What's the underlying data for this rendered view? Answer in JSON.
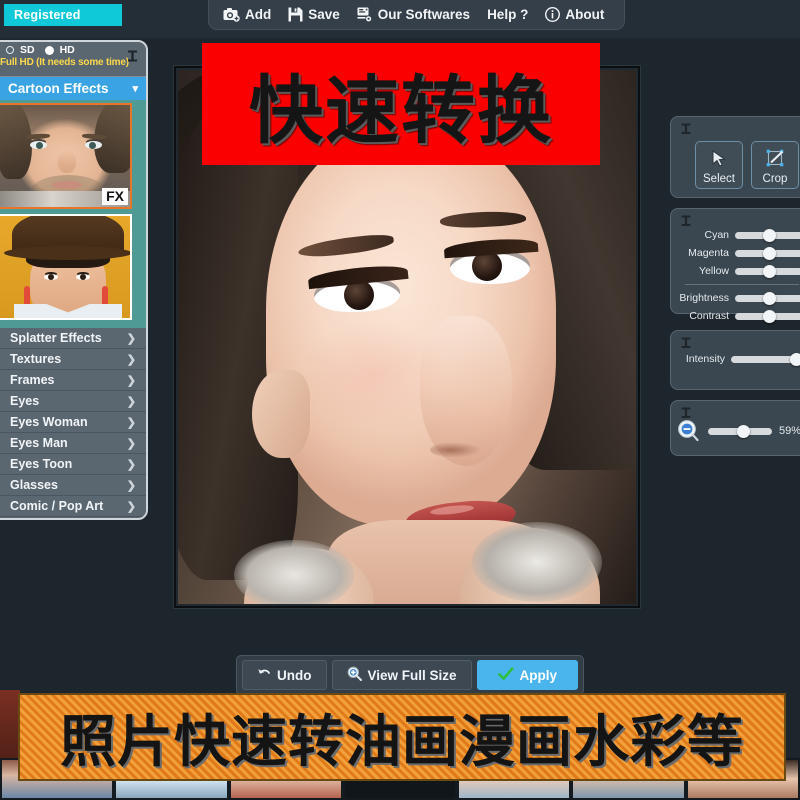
{
  "app": {
    "license_badge": "Registered"
  },
  "toolbar": {
    "items": [
      {
        "label": "Add",
        "icon": "camera-add-icon"
      },
      {
        "label": "Save",
        "icon": "floppy-disk-icon"
      },
      {
        "label": "Our Softwares",
        "icon": "monitor-icon"
      },
      {
        "label": "Help ?",
        "icon": "none"
      },
      {
        "label": "About",
        "icon": "info-circle-icon"
      }
    ]
  },
  "sidebar": {
    "quality": {
      "sd_label": "SD",
      "hd_label": "HD",
      "note": "Full HD (It needs some time)",
      "selected": "HD"
    },
    "category_header": {
      "label": "Cartoon Effects",
      "chevron": "chevron-down-icon"
    },
    "thumbnails": [
      {
        "name": "cartoon-effect-preview-1",
        "badge": "FX",
        "selected": true
      },
      {
        "name": "cartoon-effect-preview-2",
        "badge": "",
        "selected": false
      }
    ],
    "items": [
      {
        "label": "Splatter Effects"
      },
      {
        "label": "Textures"
      },
      {
        "label": "Frames"
      },
      {
        "label": "Eyes"
      },
      {
        "label": "Eyes Woman"
      },
      {
        "label": "Eyes Man"
      },
      {
        "label": "Eyes Toon"
      },
      {
        "label": "Glasses"
      },
      {
        "label": "Comic / Pop Art"
      }
    ],
    "arrow_icon": "chevron-right-icon"
  },
  "right_panel": {
    "tools": [
      {
        "label": "Select",
        "icon": "cursor-arrow-icon"
      },
      {
        "label": "Crop",
        "icon": "crop-icon"
      }
    ],
    "color_sliders": [
      {
        "label": "Cyan",
        "value": 50
      },
      {
        "label": "Magenta",
        "value": 50
      },
      {
        "label": "Yellow",
        "value": 50
      }
    ],
    "tone_sliders": [
      {
        "label": "Brightness",
        "value": 50
      },
      {
        "label": "Contrast",
        "value": 50
      }
    ],
    "intensity": {
      "label": "Intensity",
      "value": 100
    },
    "zoom": {
      "value": 45,
      "percent_label": "59%",
      "icon": "magnifier-minus-icon"
    }
  },
  "bottom_bar": {
    "buttons": [
      {
        "label": "Undo",
        "icon": "undo-arrow-icon"
      },
      {
        "label": "View Full Size",
        "icon": "magnifier-plus-icon"
      },
      {
        "label": "Apply",
        "icon": "check-icon"
      }
    ]
  },
  "overlays": {
    "top_banner": {
      "text": "快速转换",
      "bg_color": "#fb0000",
      "text_color": "#151515"
    },
    "bottom_banner": {
      "text": "照片快速转油画漫画水彩等",
      "bg_color": "#e8931f",
      "text_color": "#141414"
    }
  },
  "canvas": {
    "image_name": "cartoon-portrait-preview"
  }
}
